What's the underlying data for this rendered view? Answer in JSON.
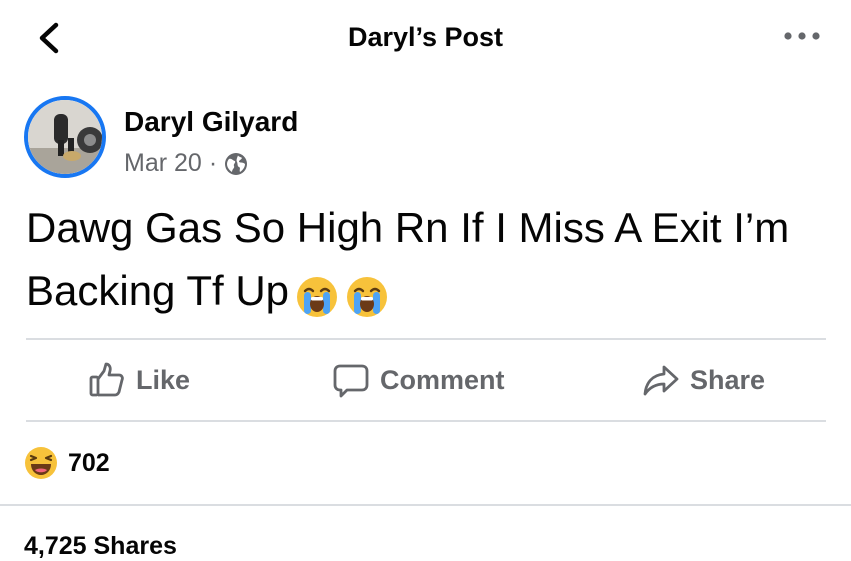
{
  "header": {
    "title": "Daryl’s Post",
    "back_icon": "chevron-left-icon",
    "more_icon": "more-dots-icon"
  },
  "post": {
    "author": "Daryl Gilyard",
    "date": "Mar 20",
    "separator": "·",
    "privacy_icon": "globe-icon",
    "text": "Dawg Gas So High Rn If I Miss A Exit I’m Backing Tf Up",
    "emojis": [
      "loudly-crying-face-icon",
      "loudly-crying-face-icon"
    ]
  },
  "actions": {
    "like": "Like",
    "comment": "Comment",
    "share": "Share"
  },
  "reactions": {
    "icon": "haha-reaction-icon",
    "count": "702"
  },
  "shares": {
    "label": "4,725 Shares"
  },
  "colors": {
    "accent": "#1877f2",
    "secondary_text": "#65676b",
    "divider": "#dadde1",
    "primary_text": "#050505"
  }
}
